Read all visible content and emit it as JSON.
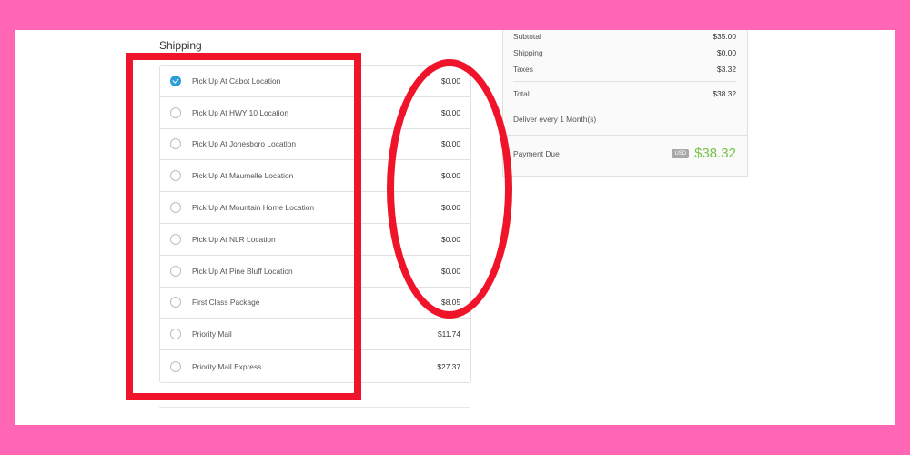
{
  "shipping": {
    "title": "Shipping",
    "options": [
      {
        "label": "Pick Up At Cabot Location",
        "price": "$0.00",
        "selected": true
      },
      {
        "label": "Pick Up At HWY 10 Location",
        "price": "$0.00",
        "selected": false
      },
      {
        "label": "Pick Up At Jonesboro Location",
        "price": "$0.00",
        "selected": false
      },
      {
        "label": "Pick Up At Maumelle Location",
        "price": "$0.00",
        "selected": false
      },
      {
        "label": "Pick Up At Mountain Home Location",
        "price": "$0.00",
        "selected": false
      },
      {
        "label": "Pick Up At NLR Location",
        "price": "$0.00",
        "selected": false
      },
      {
        "label": "Pick Up At Pine Bluff Location",
        "price": "$0.00",
        "selected": false
      },
      {
        "label": "First Class Package",
        "price": "$8.05",
        "selected": false
      },
      {
        "label": "Priority Mail",
        "price": "$11.74",
        "selected": false
      },
      {
        "label": "Priority Mail Express",
        "price": "$27.37",
        "selected": false
      }
    ]
  },
  "summary": {
    "subtotal_label": "Subtotal",
    "subtotal_value": "$35.00",
    "shipping_label": "Shipping",
    "shipping_value": "$0.00",
    "taxes_label": "Taxes",
    "taxes_value": "$3.32",
    "total_label": "Total",
    "total_value": "$38.32",
    "delivery_note": "Deliver every 1 Month(s)",
    "payment_due_label": "Payment Due",
    "currency": "USD",
    "payment_due_value": "$38.32"
  },
  "colors": {
    "background_border": "#ff66b3",
    "annotation": "#f0142a",
    "radio_selected": "#2b9fd6",
    "total_accent": "#7bc14a"
  }
}
